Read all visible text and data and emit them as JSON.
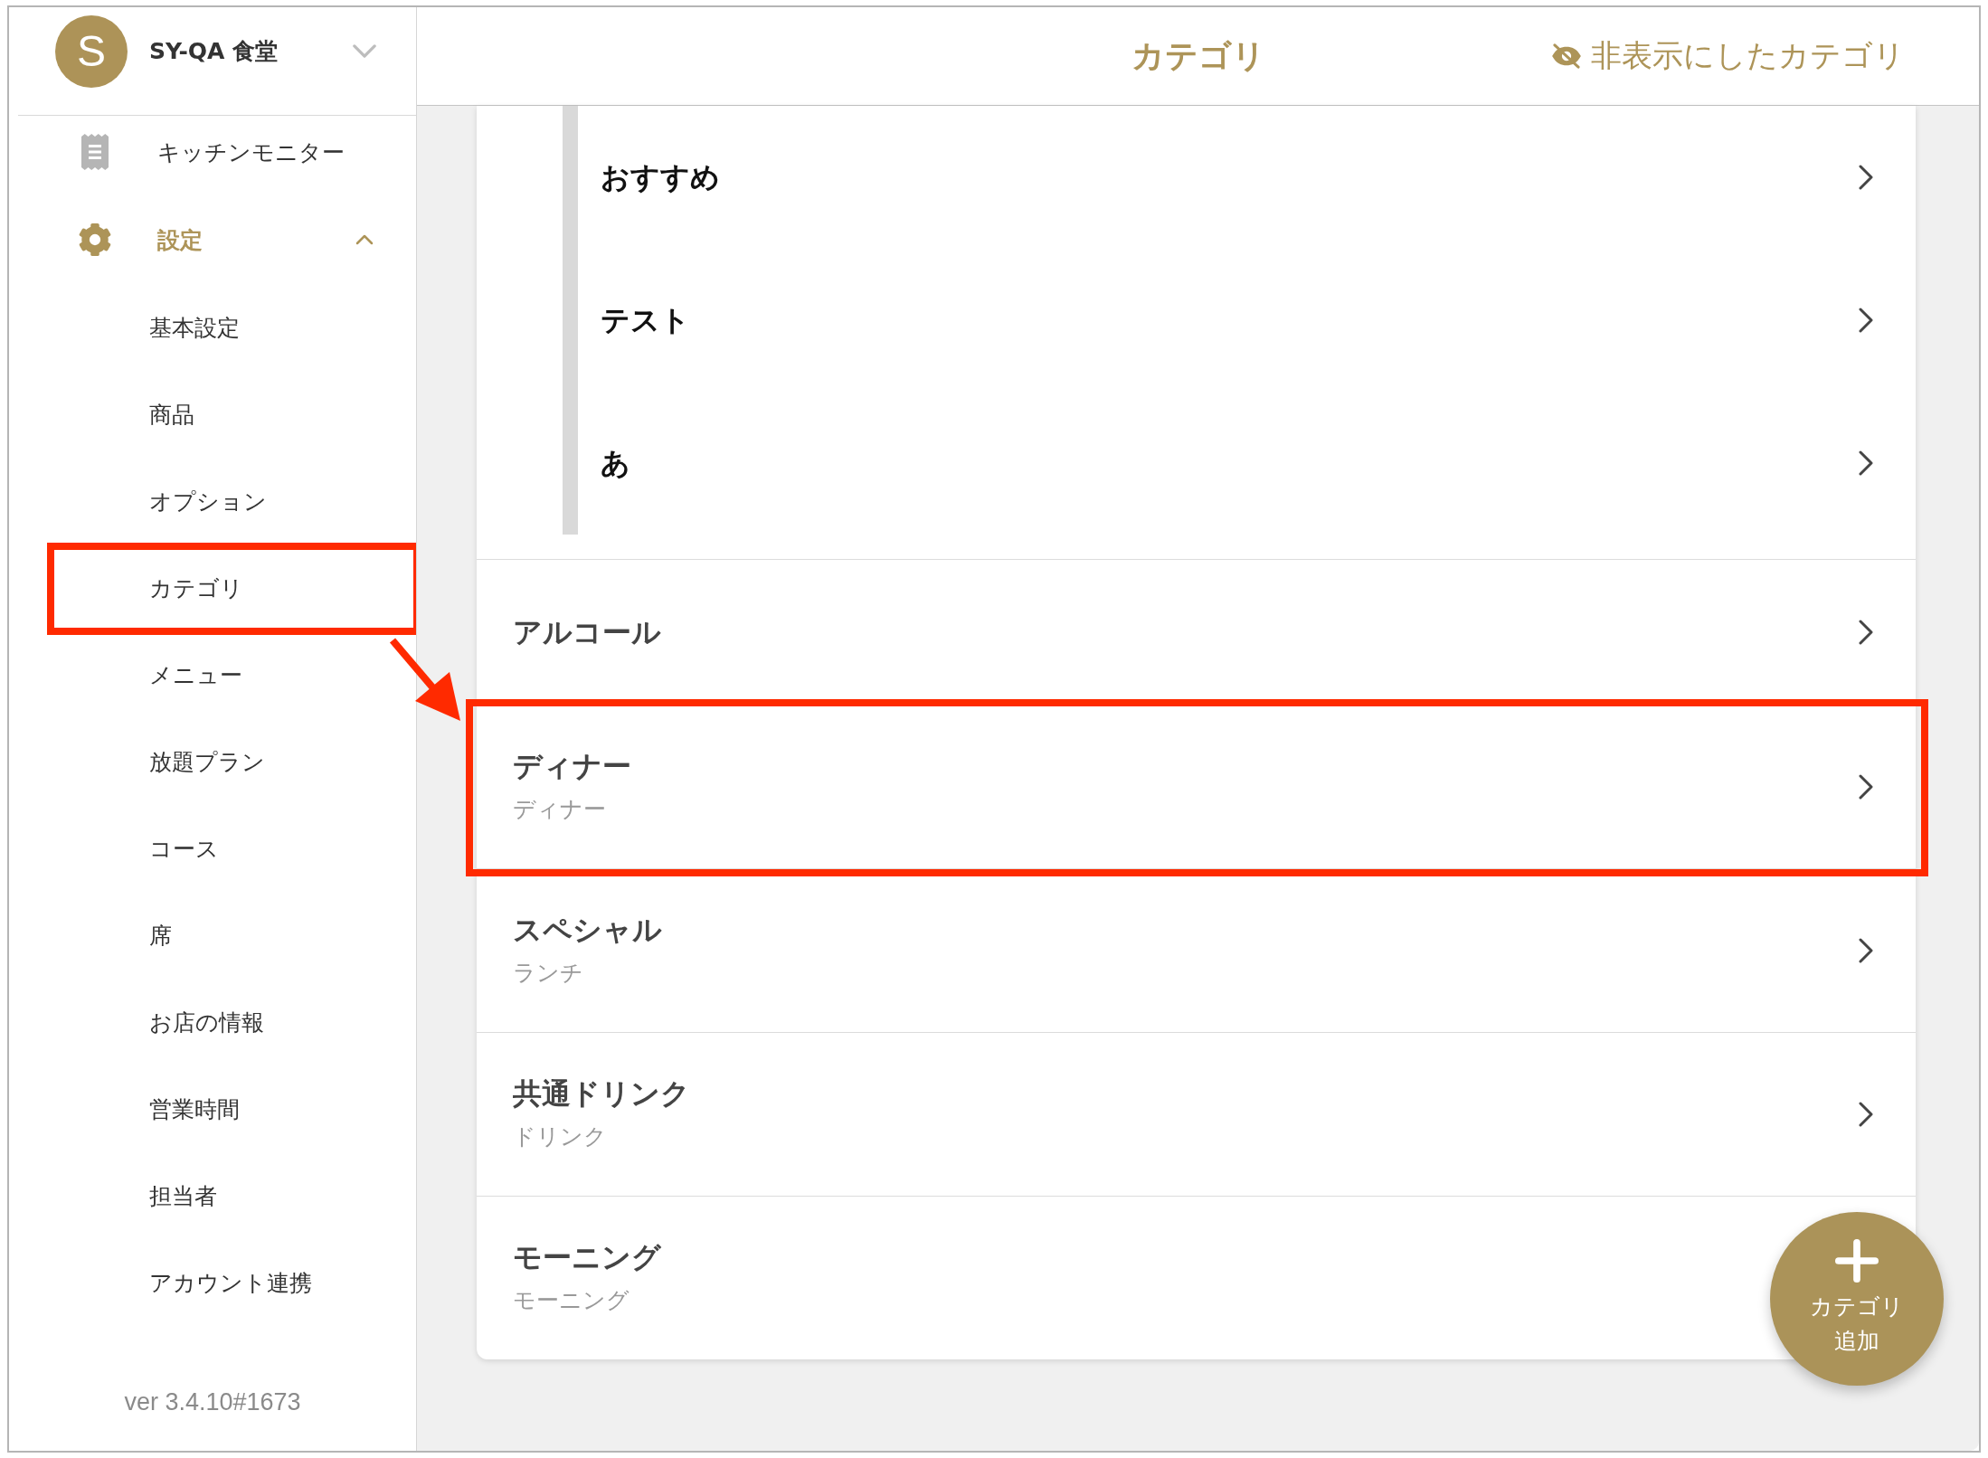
{
  "sidebar": {
    "account": {
      "avatar_letter": "S",
      "name": "SY-QA 食堂",
      "expanded": false
    },
    "kitchen_monitor": {
      "label": "キッチンモニター",
      "selected": false
    },
    "settings": {
      "label": "設定",
      "selected": true,
      "expanded": true,
      "children": [
        {
          "label": "基本設定",
          "highlighted": false
        },
        {
          "label": "商品",
          "highlighted": false
        },
        {
          "label": "オプション",
          "highlighted": false
        },
        {
          "label": "カテゴリ",
          "highlighted": true
        },
        {
          "label": "メニュー",
          "highlighted": false
        },
        {
          "label": "放題プラン",
          "highlighted": false
        },
        {
          "label": "コース",
          "highlighted": false
        },
        {
          "label": "席",
          "highlighted": false
        },
        {
          "label": "お店の情報",
          "highlighted": false
        },
        {
          "label": "営業時間",
          "highlighted": false
        },
        {
          "label": "担当者",
          "highlighted": false
        },
        {
          "label": "アカウント連携",
          "highlighted": false
        }
      ]
    },
    "version": "ver 3.4.10#1673"
  },
  "header": {
    "title": "カテゴリ",
    "hidden_categories_link": "非表示にしたカテゴリ"
  },
  "categories": [
    {
      "children": [
        {
          "name": "おすすめ",
          "highlighted": false
        },
        {
          "name": "テスト",
          "highlighted": false
        },
        {
          "name": "あ",
          "highlighted": false
        }
      ]
    },
    {
      "name": "アルコール",
      "highlighted": false
    },
    {
      "name": "ディナー",
      "subtitle": "ディナー",
      "highlighted": true
    },
    {
      "name": "スペシャル",
      "subtitle": "ランチ",
      "highlighted": false
    },
    {
      "name": "共通ドリンク",
      "subtitle": "ドリンク",
      "highlighted": false
    },
    {
      "name": "モーニング",
      "subtitle": "モーニング",
      "highlighted": false
    }
  ],
  "add_button": {
    "label": "カテゴリ追加"
  }
}
